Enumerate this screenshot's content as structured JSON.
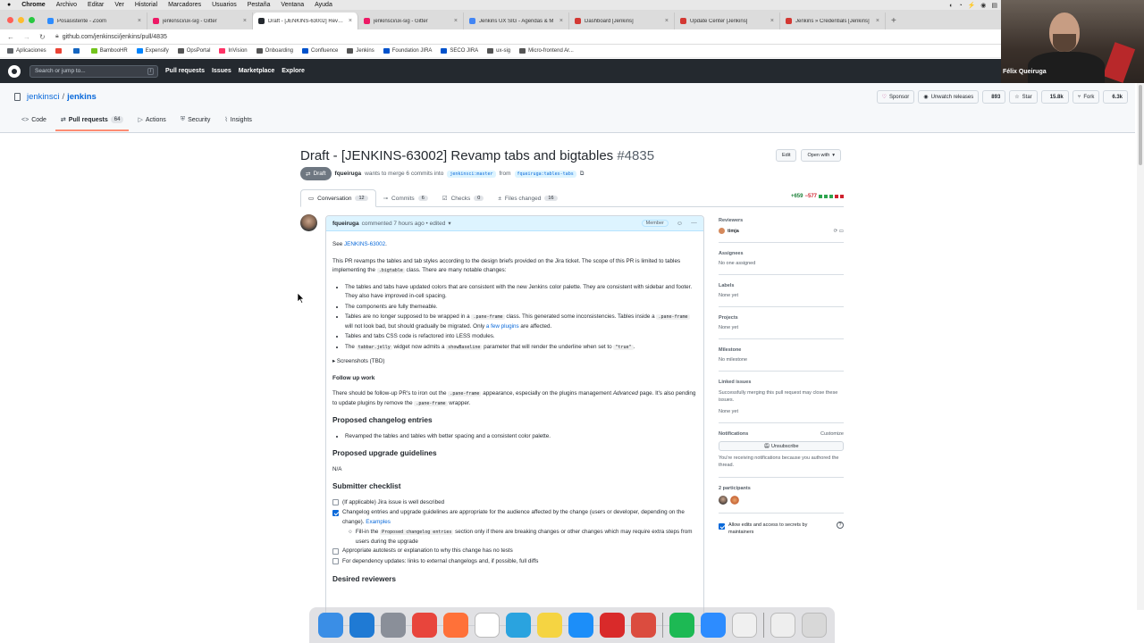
{
  "menubar": {
    "items": [
      "Chrome",
      "Archivo",
      "Editar",
      "Ver",
      "Historial",
      "Marcadores",
      "Usuarios",
      "Pestaña",
      "Ventana",
      "Ayuda"
    ]
  },
  "browser_tabs": [
    {
      "label": "Posasistente - Zoom",
      "color": "#2d8cff"
    },
    {
      "label": "jenkinsci/ux-sig - Gitter",
      "color": "#ed1965"
    },
    {
      "label": "Draft - [JENKINS-63002] Revamp tabs and bigtables",
      "color": "#24292f"
    },
    {
      "label": "jenkinsci/ux-sig - Gitter",
      "color": "#ed1965"
    },
    {
      "label": "Jenkins UX SIG - Agendas & M",
      "color": "#4285f4"
    },
    {
      "label": "Dashboard [Jenkins]",
      "color": "#d33833"
    },
    {
      "label": "Update Center [Jenkins]",
      "color": "#d33833"
    },
    {
      "label": "Jenkins » Credentials [Jenkins]",
      "color": "#d33833"
    }
  ],
  "address": {
    "url": "github.com/jenkinsci/jenkins/pull/4835"
  },
  "bookmarks": [
    {
      "label": "Aplicaciones",
      "color": "#5f6368"
    },
    {
      "label": "",
      "color": "#ea4335"
    },
    {
      "label": "",
      "color": "#1565c0"
    },
    {
      "label": "BambooHR",
      "color": "#73c41d"
    },
    {
      "label": "Expensify",
      "color": "#0185ff"
    },
    {
      "label": "OpsPortal",
      "color": "#555555"
    },
    {
      "label": "InVision",
      "color": "#ff3366"
    },
    {
      "label": "Onboarding",
      "color": "#555555"
    },
    {
      "label": "Confluence",
      "color": "#0052cc"
    },
    {
      "label": "Jenkins",
      "color": "#555555"
    },
    {
      "label": "Foundation JIRA",
      "color": "#0052cc"
    },
    {
      "label": "SECO JIRA",
      "color": "#0052cc"
    },
    {
      "label": "ux-sig",
      "color": "#555555"
    },
    {
      "label": "Micro-frontend Ar...",
      "color": "#555555"
    }
  ],
  "github": {
    "search_placeholder": "Search or jump to...",
    "search_shortcut": "/",
    "nav": [
      "Pull requests",
      "Issues",
      "Marketplace",
      "Explore"
    ],
    "user_name": "Félix Queiruga"
  },
  "repo": {
    "owner": "jenkinsci",
    "sep": "/",
    "name": "jenkins",
    "sponsor": "Sponsor",
    "watch": "Unwatch releases",
    "watch_count": "893",
    "star": "Star",
    "star_count": "15.8k",
    "fork": "Fork",
    "fork_count": "6.3k",
    "tabs": [
      {
        "label": "Code",
        "count": ""
      },
      {
        "label": "Pull requests",
        "count": "64"
      },
      {
        "label": "Actions",
        "count": ""
      },
      {
        "label": "Security",
        "count": ""
      },
      {
        "label": "Insights",
        "count": ""
      }
    ]
  },
  "pr": {
    "title": "Draft - [JENKINS-63002] Revamp tabs and bigtables",
    "number": "#4835",
    "edit": "Edit",
    "open_with": "Open with",
    "status": "Draft",
    "author": "fqueiruga",
    "wants": "wants to merge 6 commits into",
    "base": "jenkinsci:master",
    "from": "from",
    "head": "fqueiruga:tables-tabs",
    "tabs": [
      {
        "label": "Conversation",
        "count": "12"
      },
      {
        "label": "Commits",
        "count": "6"
      },
      {
        "label": "Checks",
        "count": "0"
      },
      {
        "label": "Files changed",
        "count": "16"
      }
    ],
    "additions": "+659",
    "deletions": "−577"
  },
  "comment": {
    "author": "fqueiruga",
    "meta": "commented 7 hours ago • edited",
    "badge": "Member",
    "see": "See",
    "see_link": "JENKINS-63002",
    "see_end": ".",
    "intro": "This PR revamps the tables and tab styles according to the design briefs provided on the Jira ticket. The scope of this PR is limited to tables implementing the",
    "intro_code": ".bigtable",
    "intro_end": "class. There are many notable changes:",
    "b1": "The tables and tabs have updated colors that are consistent with the new Jenkins color palette. They are consistent with sidebar and footer. They also have improved in-cell spacing.",
    "b2": "The components are fully themeable.",
    "b3a": "Tables are no longer supposed to be wrapped in a",
    "b3code": ".pane-frame",
    "b3b": "class. This generated some inconsistencies. Tables inside a",
    "b3code2": ".pane-frame",
    "b3c": "will not look bad, but should gradually be migrated. Only",
    "b3link": "a few plugins",
    "b3d": "are affected.",
    "b4": "Tables and tabs CSS code is refactored into LESS modules.",
    "b5a": "The",
    "b5code": "tabbar.jelly",
    "b5b": "widget now admits a",
    "b5code2": "showBaseline",
    "b5c": "parameter that will render the underline when set to",
    "b5code3": "\"true\"",
    "b5d": ".",
    "screens": "Screenshots (TBD)",
    "followup_h": "Follow up work",
    "followup_a": "There should be follow-up PR's to iron out the",
    "followup_code": ".pane-frame",
    "followup_b": "appearance, especially on the plugins management",
    "followup_em": "Advanced",
    "followup_c": "page. It's also pending to update plugins by remove the",
    "followup_code2": ".pane-frame",
    "followup_d": "wrapper.",
    "changelog_h": "Proposed changelog entries",
    "changelog_item": "Revamped the tables and tables with better spacing and a consistent color palette.",
    "upgrade_h": "Proposed upgrade guidelines",
    "upgrade_val": "N/A",
    "checklist_h": "Submitter checklist",
    "c1": "(If applicable) Jira issue is well described",
    "c2": "Changelog entries and upgrade guidelines are appropriate for the audience affected by the change (users or developer, depending on the change).",
    "c2link": "Examples",
    "c2sub_a": "Fill-in the",
    "c2sub_code": "Proposed changelog entries",
    "c2sub_b": "section only if there are breaking changes or other changes which may require extra steps from users during the upgrade",
    "c3": "Appropriate autotests or explanation to why this change has no tests",
    "c4": "For dependency updates: links to external changelogs and, if possible, full diffs",
    "reviewers_h": "Desired reviewers"
  },
  "sidebar": {
    "reviewers_h": "Reviewers",
    "reviewer": "timja",
    "assignees_h": "Assignees",
    "assignees_v": "No one assigned",
    "labels_h": "Labels",
    "labels_v": "None yet",
    "projects_h": "Projects",
    "projects_v": "None yet",
    "milestone_h": "Milestone",
    "milestone_v": "No milestone",
    "linked_h": "Linked issues",
    "linked_desc": "Successfully merging this pull request may close these issues.",
    "linked_v": "None yet",
    "notif_h": "Notifications",
    "notif_customize": "Customize",
    "unsubscribe": "Unsubscribe",
    "notif_desc": "You're receiving notifications because you authored the thread.",
    "participants_h": "2 participants",
    "allow_edits": "Allow edits and access to secrets by maintainers"
  },
  "dock": [
    {
      "name": "finder",
      "color": "#3a8ee6"
    },
    {
      "name": "vscode",
      "color": "#1f7ad4"
    },
    {
      "name": "launchpad",
      "color": "#8a8f99"
    },
    {
      "name": "chrome",
      "color": "#e8453c"
    },
    {
      "name": "firefox",
      "color": "#ff7139"
    },
    {
      "name": "slack",
      "color": "#ffffff"
    },
    {
      "name": "telegram",
      "color": "#2aa3df"
    },
    {
      "name": "notes",
      "color": "#f5d442"
    },
    {
      "name": "app-store",
      "color": "#1c8ef9"
    },
    {
      "name": "more",
      "color": "#d92a2a"
    },
    {
      "name": "todoist",
      "color": "#db4c3f"
    },
    {
      "name": "spotify",
      "color": "#1db954"
    },
    {
      "name": "zoom",
      "color": "#2d8cff"
    },
    {
      "name": "inkscape",
      "color": "#f0f0f0"
    },
    {
      "name": "document",
      "color": "#eeeeee"
    },
    {
      "name": "trash",
      "color": "#d8d8d8"
    }
  ]
}
